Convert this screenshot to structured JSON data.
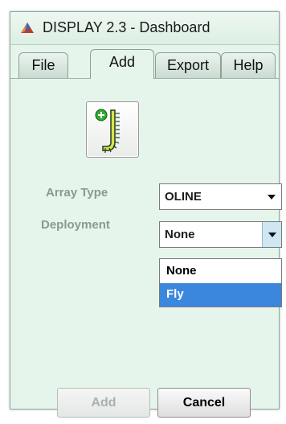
{
  "window": {
    "title": "DISPLAY 2.3 - Dashboard",
    "app_icon": "matlab-icon"
  },
  "tabs": [
    {
      "label": "File",
      "active": false
    },
    {
      "label": "Add",
      "active": true
    },
    {
      "label": "Export",
      "active": false
    },
    {
      "label": "Help",
      "active": false
    }
  ],
  "add_array_button": {
    "icon": "add-array-icon"
  },
  "array_type": {
    "label": "Array Type",
    "value": "OLINE"
  },
  "deployment": {
    "label": "Deployment",
    "value": "None",
    "options": [
      {
        "label": "None",
        "selected": false
      },
      {
        "label": "Fly",
        "selected": true
      }
    ]
  },
  "buttons": {
    "add_label": "Add",
    "add_enabled": false,
    "cancel_label": "Cancel"
  },
  "colors": {
    "panel_bg": "#e6f5ec",
    "selection": "#3b87dd",
    "label_gray": "#8a9a90"
  }
}
